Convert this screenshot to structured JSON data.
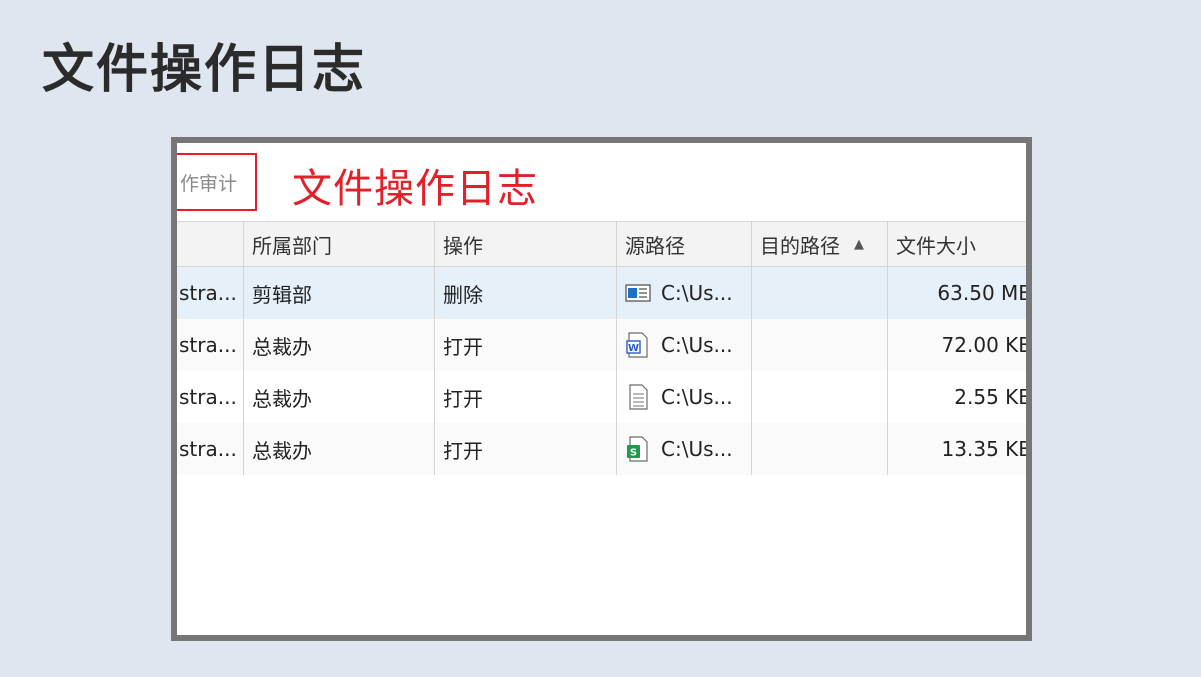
{
  "slide": {
    "title": "文件操作日志"
  },
  "screenshot": {
    "tab_label": "作审计",
    "annotation": "文件操作日志",
    "columns": [
      "",
      "所属部门",
      "操作",
      "源路径",
      "目的路径",
      "文件大小"
    ],
    "sort_indicator": "▲",
    "rows": [
      {
        "user": "stra...",
        "dept": "剪辑部",
        "op": "删除",
        "icon": "video-file-icon",
        "src": "C:\\Us...",
        "dst": "",
        "size": "63.50 MB"
      },
      {
        "user": "stra...",
        "dept": "总裁办",
        "op": "打开",
        "icon": "word-file-icon",
        "src": "C:\\Us...",
        "dst": "",
        "size": "72.00 KB"
      },
      {
        "user": "stra...",
        "dept": "总裁办",
        "op": "打开",
        "icon": "text-file-icon",
        "src": "C:\\Us...",
        "dst": "",
        "size": "2.55 KB"
      },
      {
        "user": "stra...",
        "dept": "总裁办",
        "op": "打开",
        "icon": "spreadsheet-file-icon",
        "src": "C:\\Us...",
        "dst": "",
        "size": "13.35 KB"
      }
    ]
  },
  "colors": {
    "annotation_red": "#e2202a",
    "selected_row": "#e5f0f9",
    "frame_border": "#767676",
    "background": "#dfe6f0"
  }
}
